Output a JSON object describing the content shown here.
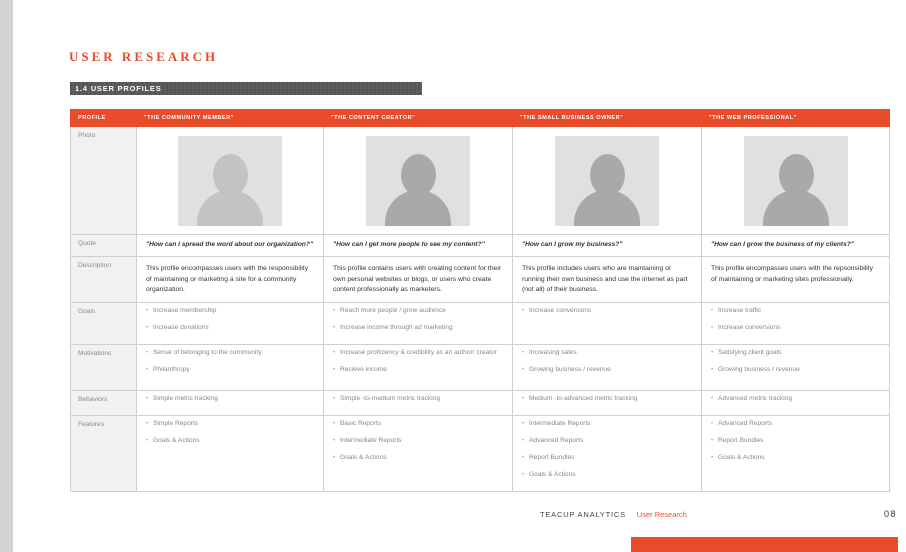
{
  "page": {
    "title": "USER RESEARCH",
    "section": "1.4 USER PROFILES",
    "accent_color": "#e84c2b"
  },
  "table": {
    "corner_label": "PROFILE",
    "row_labels": {
      "photo": "Photo",
      "quote": "Quote",
      "description": "Description",
      "goals": "Goals",
      "motivations": "Motivations",
      "behaviors": "Behaviors",
      "features": "Features"
    },
    "profiles": [
      {
        "header": "\"THE COMMUNITY MEMBER\"",
        "quote": "\"How can I spread the word about our organization?\"",
        "description": "This profile encompasses users with the responsibility of maintaining or marketing a site for a community organization.",
        "goals": [
          "Increase membership",
          "Increase donations"
        ],
        "motivations": [
          "Sense of belonging to the community",
          "Philanthropy"
        ],
        "behaviors": [
          "Simple metric tracking"
        ],
        "features": [
          "Simple Reports",
          "Goals & Actions"
        ]
      },
      {
        "header": "\"THE CONTENT CREATOR\"",
        "quote": "\"How can I get more people to see my content?\"",
        "description": "This profile contains users with creating content for their own personal websites or blogs, or users who create content professionally as marketers.",
        "goals": [
          "Reach more people / grow audience",
          "Increase income through ad marketing"
        ],
        "motivations": [
          "Increase proficiency & credibility as an author/ creator",
          "Recieve income"
        ],
        "behaviors": [
          "Simple -to-medium metric tracking"
        ],
        "features": [
          "Basic Reports",
          "Intermediate Reports",
          "Goals & Actions"
        ]
      },
      {
        "header": "\"THE SMALL BUSINESS OWNER\"",
        "quote": "\"How can I grow my business?\"",
        "description": "This profile includes users who are maintaining or running their own business and use the internet as part (not all) of their business.",
        "goals": [
          "Increase conversions"
        ],
        "motivations": [
          "Increasing sales",
          "Growing business / revenue"
        ],
        "behaviors": [
          "Medium -to-advanced metric tracking"
        ],
        "features": [
          "Intermediate Reports",
          "Advanced Reports",
          "Report Bundles",
          "Goals & Actions"
        ]
      },
      {
        "header": "\"THE WEB PROFESSIONAL\"",
        "quote": "\"How can I grow the business of my clients?\"",
        "description": "This profile encompasses users with the repsonsibility of maintaining or marketing sites professionally.",
        "goals": [
          "Increase traffic",
          "Increase conversions"
        ],
        "motivations": [
          "Satisfying client goals",
          "Growing business / revenue"
        ],
        "behaviors": [
          "Advanced metric tracking"
        ],
        "features": [
          "Advanced Reports",
          "Report Bundles",
          "Goals & Actions"
        ]
      }
    ]
  },
  "footer": {
    "company": "TEACUP ANALYTICS",
    "crumb": "User Research",
    "page_number": "08"
  }
}
